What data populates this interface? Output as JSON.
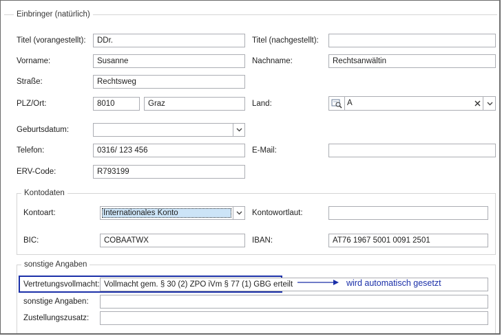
{
  "form": {
    "group_title": "Einbringer (natürlich)",
    "titel_vor": {
      "label": "Titel (vorangestellt):",
      "value": "DDr."
    },
    "titel_nach": {
      "label": "Titel (nachgestellt):",
      "value": ""
    },
    "vorname": {
      "label": "Vorname:",
      "value": "Susanne"
    },
    "nachname": {
      "label": "Nachname:",
      "value": "Rechtsanwältin"
    },
    "strasse": {
      "label": "Straße:",
      "value": "Rechtsweg"
    },
    "plz_ort": {
      "label": "PLZ/Ort:",
      "plz": "8010",
      "ort": "Graz"
    },
    "land": {
      "label": "Land:",
      "value": "A"
    },
    "geburtsdatum": {
      "label": "Geburtsdatum:",
      "value": ""
    },
    "telefon": {
      "label": "Telefon:",
      "value": "0316/ 123 456"
    },
    "email": {
      "label": "E-Mail:",
      "value": ""
    },
    "erv": {
      "label": "ERV-Code:",
      "value": "R793199"
    }
  },
  "konto": {
    "group_title": "Kontodaten",
    "kontoart": {
      "label": "Kontoart:",
      "value": "Internationales Konto"
    },
    "kontowortlaut": {
      "label": "Kontowortlaut:",
      "value": ""
    },
    "bic": {
      "label": "BIC:",
      "value": "COBAATWX"
    },
    "iban": {
      "label": "IBAN:",
      "value": "AT76 1967 5001 0091 2501"
    }
  },
  "sonstige": {
    "group_title": "sonstige Angaben",
    "vollmacht": {
      "label": "Vertretungsvollmacht:",
      "value": "Vollmacht gem. § 30 (2) ZPO iVm § 77 (1) GBG erteilt"
    },
    "angaben": {
      "label": "sonstige Angaben:",
      "value": ""
    },
    "zusatz": {
      "label": "Zustellungszusatz:",
      "value": ""
    }
  },
  "annotation": {
    "text": "wird automatisch gesetzt",
    "color": "#1a2fa8"
  },
  "icons": {
    "lookup": "lookup-icon",
    "clear": "clear-icon",
    "dropdown": "chevron-down-icon"
  }
}
